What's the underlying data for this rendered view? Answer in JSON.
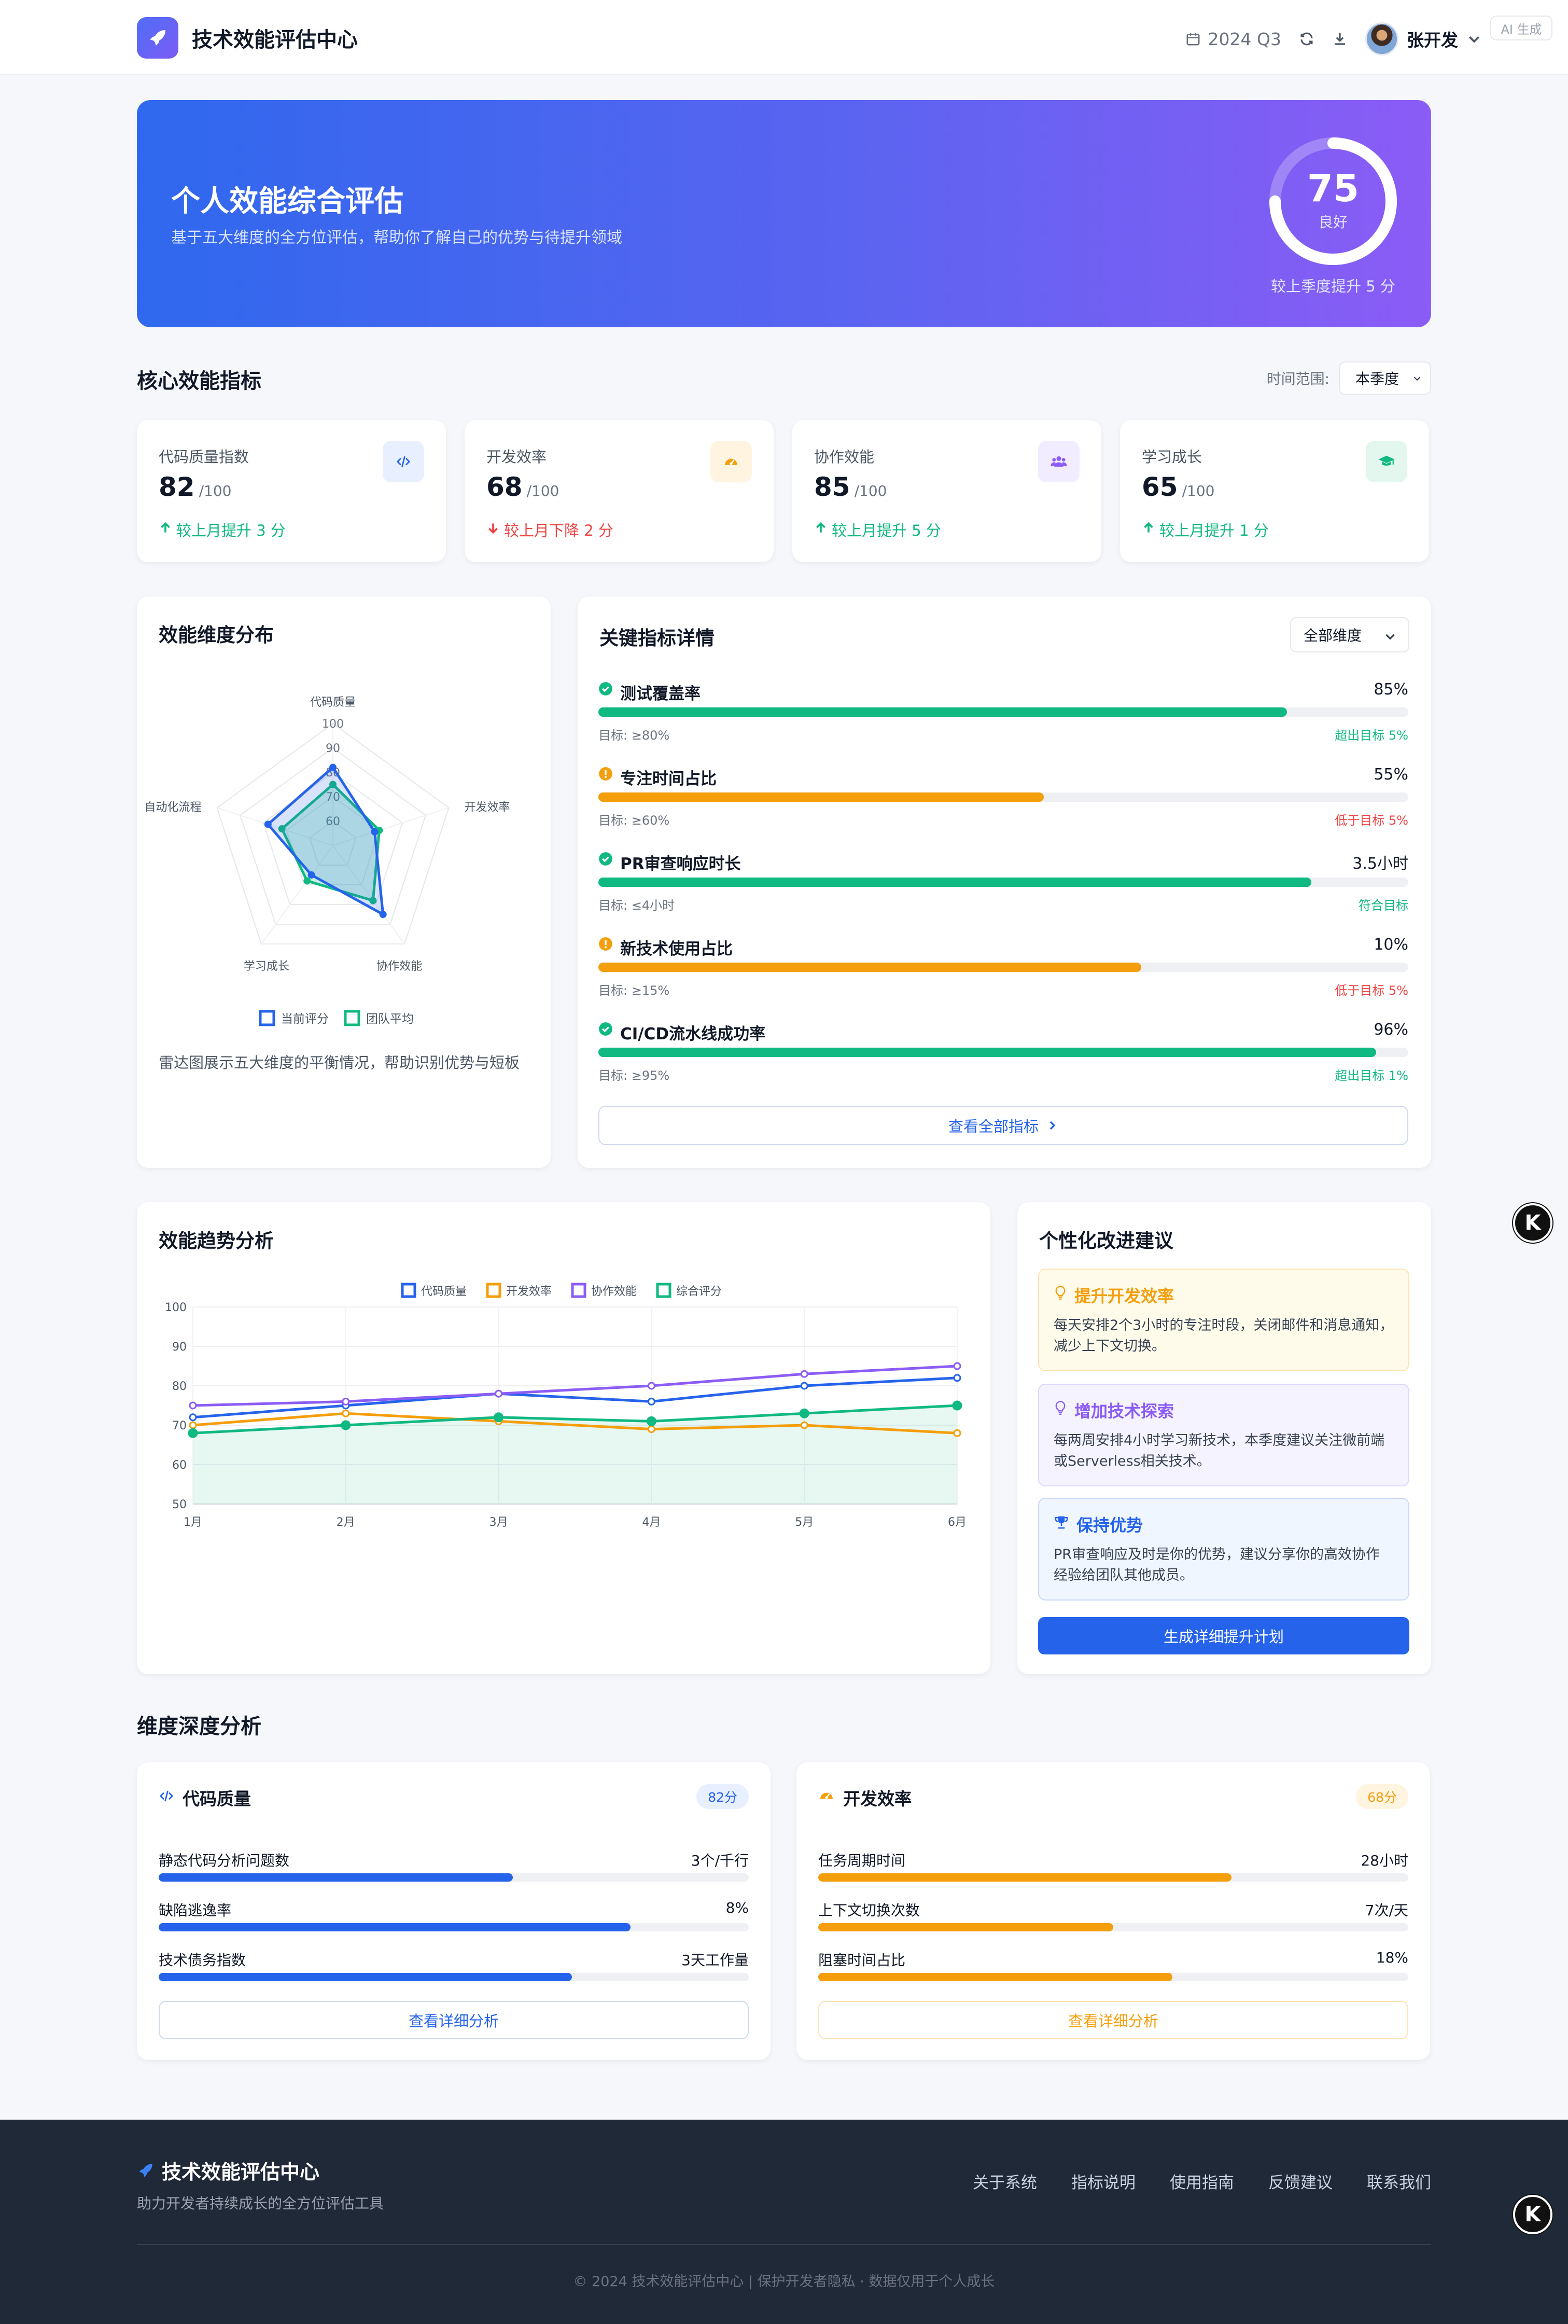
{
  "header": {
    "app_title": "技术效能评估中心",
    "quarter": "2024 Q3",
    "user_name": "张开发",
    "ai_badge": "AI 生成"
  },
  "hero": {
    "title": "个人效能综合评估",
    "subtitle": "基于五大维度的全方位评估，帮助你了解自己的优势与待提升领域",
    "score": "75",
    "score_value": 75,
    "score_max": 100,
    "level": "良好",
    "note": "较上季度提升 5 分"
  },
  "kpi_section": {
    "title": "核心效能指标",
    "range_label": "时间范围:",
    "range_value": "本季度"
  },
  "kpis": [
    {
      "label": "代码质量指数",
      "value": "82",
      "max": "/100",
      "trend": "较上月提升 3 分",
      "direction": "up",
      "icon": "code-icon"
    },
    {
      "label": "开发效率",
      "value": "68",
      "max": "/100",
      "trend": "较上月下降 2 分",
      "direction": "down",
      "icon": "gauge-icon"
    },
    {
      "label": "协作效能",
      "value": "85",
      "max": "/100",
      "trend": "较上月提升 5 分",
      "direction": "up",
      "icon": "users-icon"
    },
    {
      "label": "学习成长",
      "value": "65",
      "max": "/100",
      "trend": "较上月提升 1 分",
      "direction": "up",
      "icon": "graduation-cap-icon"
    }
  ],
  "radar": {
    "title": "效能维度分布",
    "axes": [
      "代码质量",
      "开发效率",
      "协作效能",
      "学习成长",
      "自动化流程"
    ],
    "ticks": [
      "60",
      "70",
      "80",
      "90",
      "100"
    ],
    "range": [
      50,
      100
    ],
    "series": [
      {
        "name": "当前评分",
        "color": "#2563eb",
        "values": [
          82,
          68,
          85,
          65,
          78
        ]
      },
      {
        "name": "团队平均",
        "color": "#10b981",
        "values": [
          75,
          70,
          78,
          68,
          72
        ]
      }
    ],
    "description": "雷达图展示五大维度的平衡情况，帮助识别优势与短板"
  },
  "metrics": {
    "title": "关键指标详情",
    "filter": "全部维度",
    "items": [
      {
        "name": "测试覆盖率",
        "value": "85%",
        "fill": 0.85,
        "target": "目标: ≥80%",
        "status": "超出目标 5%",
        "state": "ok"
      },
      {
        "name": "专注时间占比",
        "value": "55%",
        "fill": 0.55,
        "target": "目标: ≥60%",
        "status": "低于目标 5%",
        "state": "warn"
      },
      {
        "name": "PR审查响应时长",
        "value": "3.5小时",
        "fill": 0.88,
        "target": "目标: ≤4小时",
        "status": "符合目标",
        "state": "ok"
      },
      {
        "name": "新技术使用占比",
        "value": "10%",
        "fill": 0.67,
        "target": "目标: ≥15%",
        "status": "低于目标 5%",
        "state": "warn"
      },
      {
        "name": "CI/CD流水线成功率",
        "value": "96%",
        "fill": 0.96,
        "target": "目标: ≥95%",
        "status": "超出目标 1%",
        "state": "ok"
      }
    ],
    "view_all": "查看全部指标"
  },
  "chart_data": {
    "type": "line",
    "title": "效能趋势分析",
    "categories": [
      "1月",
      "2月",
      "3月",
      "4月",
      "5月",
      "6月"
    ],
    "ylim": [
      50,
      100
    ],
    "yticks": [
      "50",
      "60",
      "70",
      "80",
      "90",
      "100"
    ],
    "legend_position": "top",
    "series": [
      {
        "name": "代码质量",
        "color": "#2563eb",
        "values": [
          72,
          75,
          78,
          76,
          80,
          82
        ]
      },
      {
        "name": "开发效率",
        "color": "#f59e0b",
        "values": [
          70,
          73,
          71,
          69,
          70,
          68
        ]
      },
      {
        "name": "协作效能",
        "color": "#8b5cf6",
        "values": [
          75,
          76,
          78,
          80,
          83,
          85
        ]
      },
      {
        "name": "综合评分",
        "color": "#10b981",
        "values": [
          68,
          70,
          72,
          71,
          73,
          75
        ]
      }
    ]
  },
  "suggestions": {
    "title": "个性化改进建议",
    "items": [
      {
        "title": "提升开发效率",
        "body": "每天安排2个3小时的专注时段，关闭邮件和消息通知，减少上下文切换。",
        "icon": "lightbulb-icon",
        "color": "#f59e0b",
        "bg": "#fffbeb",
        "border": "#fde3b0"
      },
      {
        "title": "增加技术探索",
        "body": "每两周安排4小时学习新技术，本季度建议关注微前端或Serverless相关技术。",
        "icon": "lightbulb-icon",
        "color": "#8b5cf6",
        "bg": "#f5f3ff",
        "border": "#ddd6fe"
      },
      {
        "title": "保持优势",
        "body": "PR审查响应及时是你的优势，建议分享你的高效协作经验给团队其他成员。",
        "icon": "trophy-icon",
        "color": "#2563eb",
        "bg": "#eff6ff",
        "border": "#c7d7f7"
      }
    ],
    "button": "生成详细提升计划"
  },
  "dimensions": {
    "title": "维度深度分析",
    "panels": [
      {
        "title": "代码质量",
        "score": "82分",
        "color": "#2563eb",
        "icon": "code-icon",
        "rows": [
          {
            "name": "静态代码分析问题数",
            "value": "3个/千行",
            "fill": 0.6
          },
          {
            "name": "缺陷逃逸率",
            "value": "8%",
            "fill": 0.8
          },
          {
            "name": "技术债务指数",
            "value": "3天工作量",
            "fill": 0.7
          }
        ],
        "button": "查看详细分析"
      },
      {
        "title": "开发效率",
        "score": "68分",
        "color": "#f59e0b",
        "icon": "gauge-icon",
        "rows": [
          {
            "name": "任务周期时间",
            "value": "28小时",
            "fill": 0.7
          },
          {
            "name": "上下文切换次数",
            "value": "7次/天",
            "fill": 0.5
          },
          {
            "name": "阻塞时间占比",
            "value": "18%",
            "fill": 0.6
          }
        ],
        "button": "查看详细分析"
      }
    ]
  },
  "footer": {
    "brand": "技术效能评估中心",
    "tagline": "助力开发者持续成长的全方位评估工具",
    "links": [
      "关于系统",
      "指标说明",
      "使用指南",
      "反馈建议",
      "联系我们"
    ],
    "copyright": "© 2024 技术效能评估中心 | 保护开发者隐私 · 数据仅用于个人成长"
  },
  "float_badge": "K"
}
